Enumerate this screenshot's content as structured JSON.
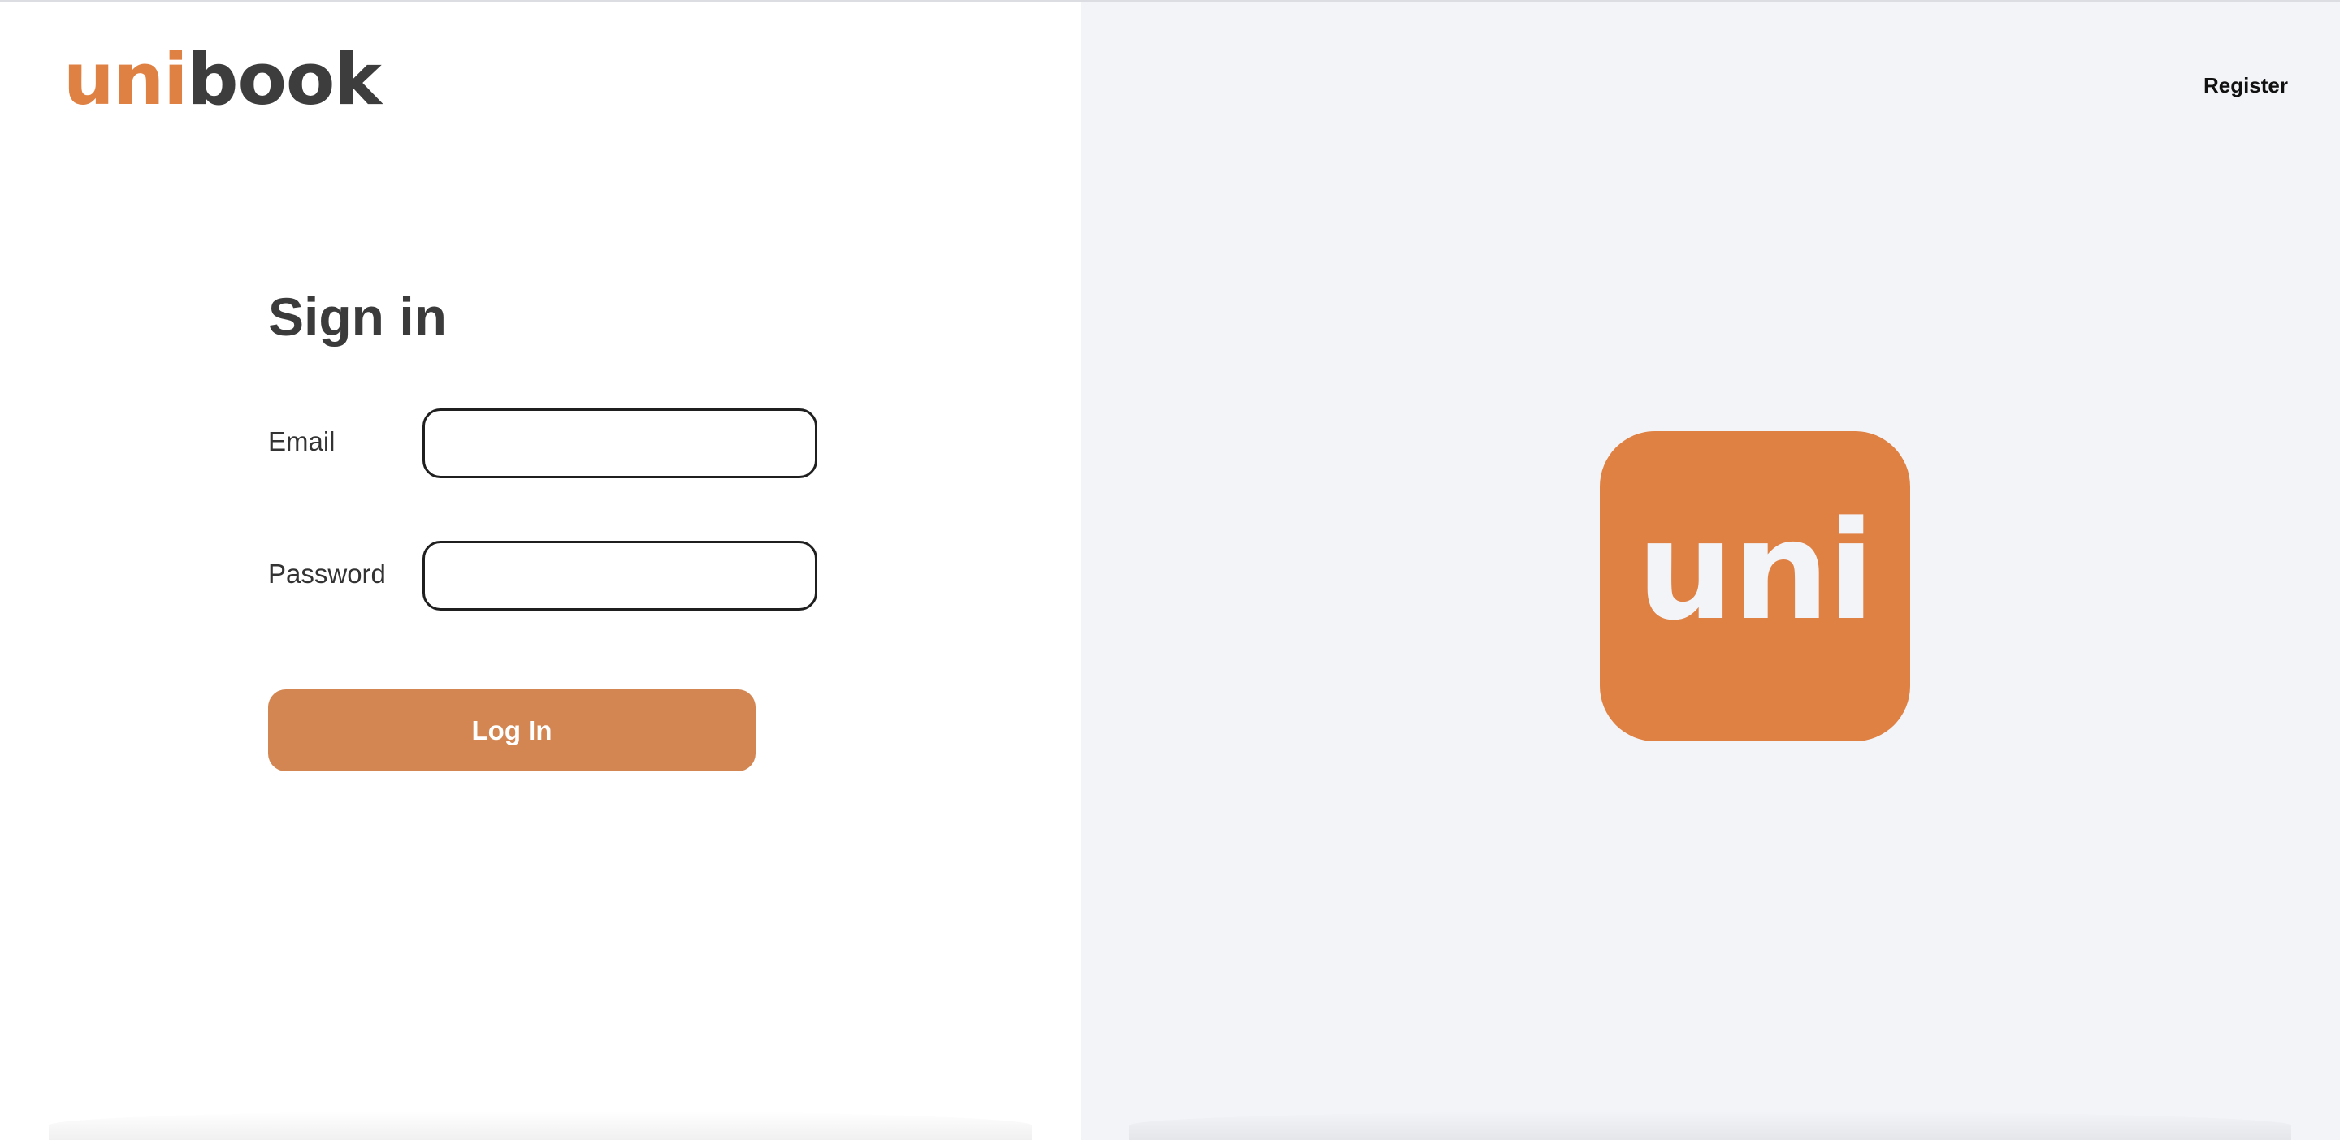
{
  "brand": {
    "logo_part1": "uni",
    "logo_part2": "book",
    "accent_color": "#e08144",
    "dark_color": "#3d3d3d"
  },
  "header": {
    "register_label": "Register"
  },
  "signin": {
    "title": "Sign in",
    "email_label": "Email",
    "email_value": "",
    "password_label": "Password",
    "password_value": "",
    "login_label": "Log In"
  },
  "app_icon": {
    "text": "uni"
  }
}
